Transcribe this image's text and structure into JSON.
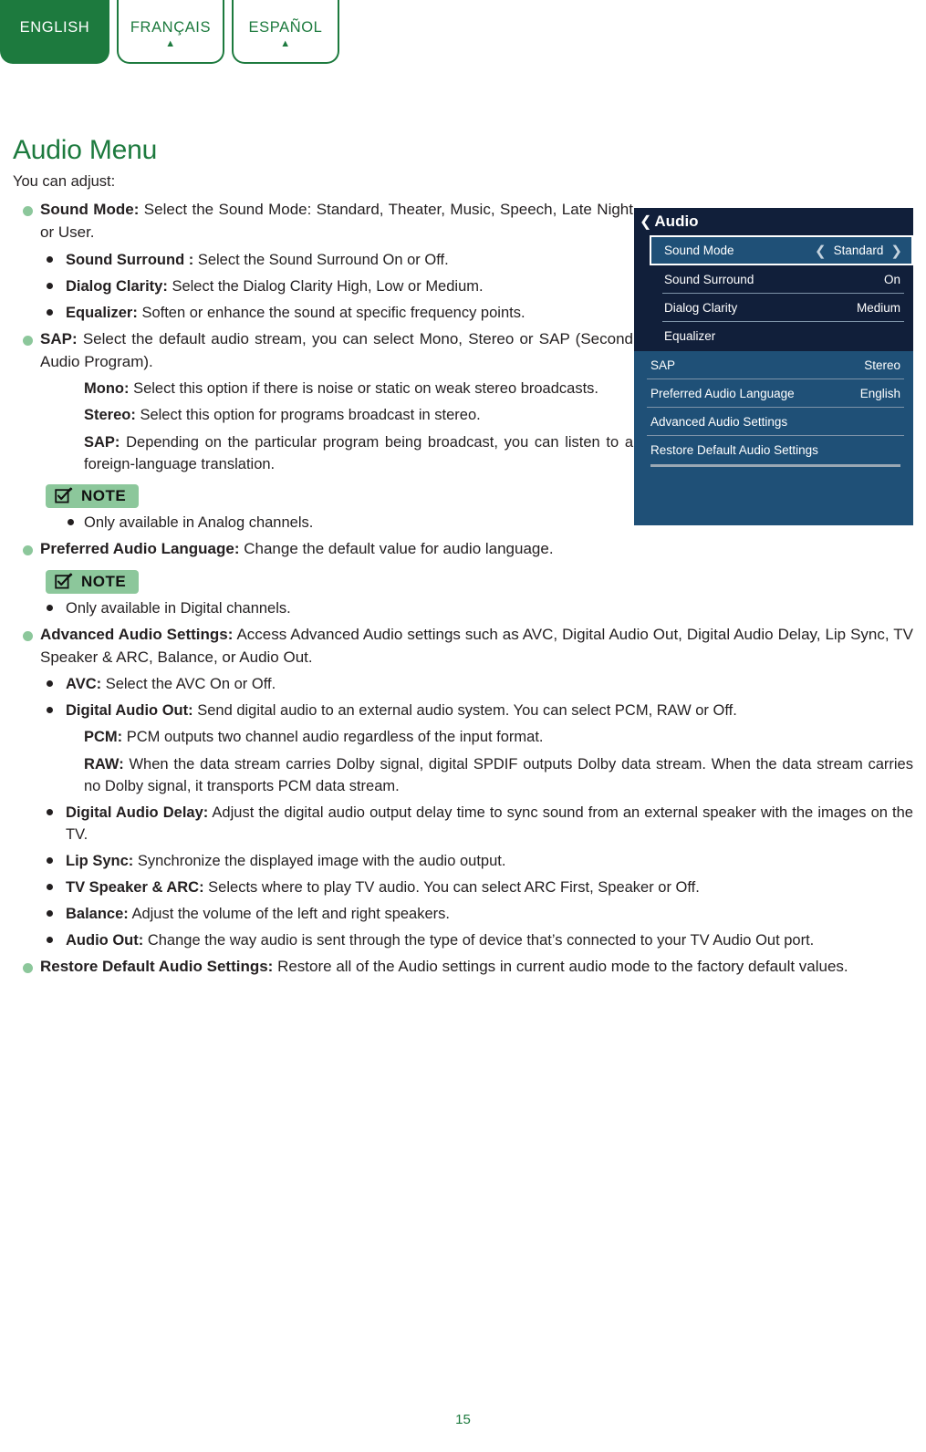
{
  "language_tabs": [
    {
      "label": "ENGLISH",
      "active": true
    },
    {
      "label": "FRANÇAIS",
      "active": false
    },
    {
      "label": "ESPAÑOL",
      "active": false
    }
  ],
  "heading": "Audio Menu",
  "lead": "You can adjust:",
  "note_label": "NOTE",
  "page_number": "15",
  "colors": {
    "brand_green": "#1d7a3e",
    "bullet_green": "#8cc79b",
    "note_bg": "#8cc79b",
    "osd_dark": "#111f3a",
    "osd_blue": "#1f5077"
  },
  "body": {
    "sound_mode": {
      "term": "Sound Mode:",
      "text": " Select the Sound Mode: Standard, Theater, Music, Speech, Late Night or User."
    },
    "sound_surround": {
      "term": "Sound Surround :",
      "text": " Select the Sound Surround On or Off."
    },
    "dialog_clarity": {
      "term": "Dialog Clarity:",
      "text": " Select the Dialog Clarity High, Low or Medium."
    },
    "equalizer": {
      "term": "Equalizer:",
      "text": " Soften or enhance the sound at specific frequency points."
    },
    "sap": {
      "term": "SAP:",
      "text": " Select the default audio stream, you can select Mono, Stereo or SAP (Second Audio Program)."
    },
    "mono": {
      "term": "Mono:",
      "text": " Select this option if there is noise or static on weak stereo broadcasts."
    },
    "stereo": {
      "term": "Stereo:",
      "text": " Select this option for programs broadcast in stereo."
    },
    "sap_sub": {
      "term": "SAP:",
      "text": " Depending on the particular program being broadcast, you can listen to a foreign-language translation."
    },
    "note_analog": "Only available in Analog channels.",
    "preferred_audio_language": {
      "term": "Preferred Audio Language:",
      "text": " Change the default value for audio language."
    },
    "note_digital": "Only available in Digital channels.",
    "advanced_audio_settings": {
      "term": "Advanced Audio Settings:",
      "text": " Access Advanced Audio settings such as AVC, Digital Audio Out, Digital Audio Delay, Lip Sync, TV Speaker & ARC, Balance, or Audio Out."
    },
    "avc": {
      "term": "AVC:",
      "text": " Select the AVC On or Off."
    },
    "digital_audio_out": {
      "term": "Digital Audio Out:",
      "text": " Send digital audio to an external audio system. You can select PCM, RAW or Off."
    },
    "pcm": {
      "term": "PCM:",
      "text": " PCM outputs two channel audio regardless of the input format."
    },
    "raw": {
      "term": "RAW:",
      "text": " When the data stream carries Dolby signal, digital SPDIF outputs Dolby data stream. When the data stream carries no Dolby signal, it transports PCM data stream."
    },
    "digital_audio_delay": {
      "term": "Digital Audio Delay:",
      "text": " Adjust the digital audio output delay time to sync sound from an external speaker with the images on the TV."
    },
    "lip_sync": {
      "term": "Lip Sync:",
      "text": " Synchronize the displayed image with the audio output."
    },
    "tv_speaker_arc": {
      "term": "TV Speaker & ARC:",
      "text": " Selects where to play TV audio. You can select ARC First, Speaker or Off."
    },
    "balance": {
      "term": "Balance:",
      "text": " Adjust the volume of the left and right speakers."
    },
    "audio_out": {
      "term": "Audio Out:",
      "text": " Change the way audio is sent through the type of device that’s connected to your TV Audio Out port."
    },
    "restore_default": {
      "term": "Restore Default Audio Settings:",
      "text": " Restore all of the Audio settings in current audio mode to the factory default values."
    }
  },
  "osd": {
    "title": "Audio",
    "back_chevron": "❮",
    "left_chevron": "❮",
    "right_chevron": "❯",
    "top_items": [
      {
        "label": "Sound Mode",
        "value": "Standard",
        "selected": true
      },
      {
        "label": "Sound Surround",
        "value": "On",
        "selected": false
      },
      {
        "label": "Dialog Clarity",
        "value": "Medium",
        "selected": false
      },
      {
        "label": "Equalizer",
        "value": "",
        "selected": false
      }
    ],
    "bottom_items": [
      {
        "label": "SAP",
        "value": "Stereo"
      },
      {
        "label": "Preferred Audio Language",
        "value": "English"
      },
      {
        "label": "Advanced Audio Settings",
        "value": ""
      },
      {
        "label": "Restore Default Audio Settings",
        "value": ""
      }
    ]
  }
}
